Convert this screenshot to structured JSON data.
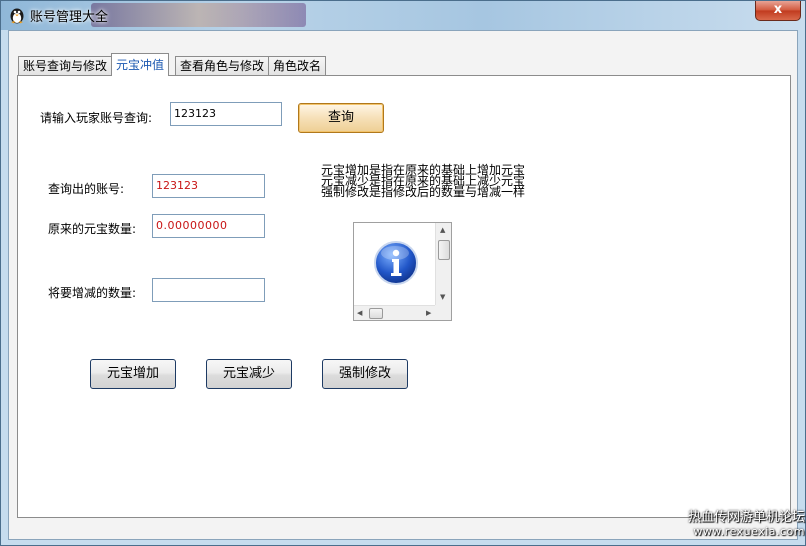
{
  "window": {
    "title": "账号管理大全",
    "close_label": "x"
  },
  "tabs": [
    {
      "label": "账号查询与修改",
      "active": false
    },
    {
      "label": "元宝冲值",
      "active": true
    },
    {
      "label": "查看角色与修改",
      "active": false
    },
    {
      "label": "角色改名",
      "active": false
    }
  ],
  "query": {
    "label": "请输入玩家账号查询:",
    "value": "123123",
    "button": "查询"
  },
  "fields": {
    "account_label": "查询出的账号:",
    "account_value": "123123",
    "original_label": "原来的元宝数量:",
    "original_value": "0.00000000",
    "change_label": "将要增减的数量:",
    "change_value": ""
  },
  "info": {
    "line1": "元宝增加是指在原来的基础上增加元宝",
    "line2": "元宝减少是指在原来的基础上减少元宝",
    "line3": "强制修改是指修改后的数量与增减一样"
  },
  "buttons": {
    "add": "元宝增加",
    "reduce": "元宝减少",
    "force": "强制修改"
  },
  "watermark": {
    "line1": "热血传网游单机论坛",
    "url": "www.rexuexia.com"
  },
  "colors": {
    "accent": "#1a57b0",
    "value_red": "#c81414",
    "close_red": "#c03a1e"
  }
}
